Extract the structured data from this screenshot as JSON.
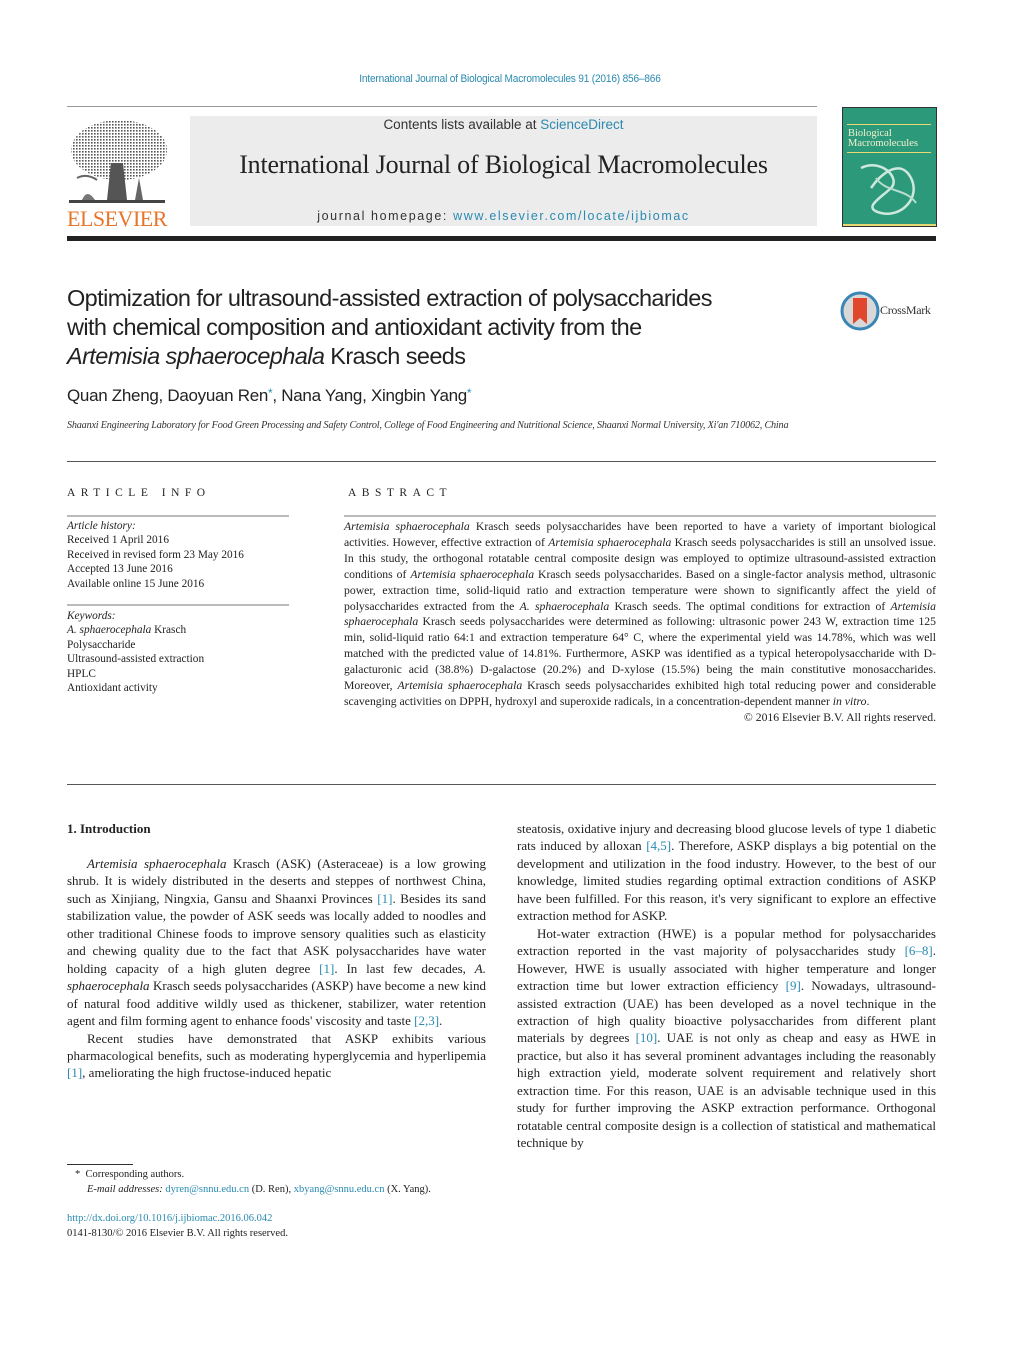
{
  "header": {
    "citation": "International Journal of Biological Macromolecules 91 (2016) 856–866",
    "contents_prefix": "Contents lists available at ",
    "contents_link": "ScienceDirect",
    "journal_name": "International Journal of Biological Macromolecules",
    "homepage_prefix": "journal homepage: ",
    "homepage_link": "www.elsevier.com/locate/ijbiomac",
    "publisher_logo_text": "ELSEVIER",
    "cover_title_line1": "Biological",
    "cover_title_line2": "Macromolecules",
    "crossmark_label": "CrossMark"
  },
  "colors": {
    "link": "#2a8ab0",
    "elsevier_orange": "#e8752a",
    "banner_gray": "#ececec",
    "cover_green": "#2c9a7a"
  },
  "article": {
    "title_line1": "Optimization for ultrasound-assisted extraction of polysaccharides",
    "title_line2": "with chemical composition and antioxidant activity from the",
    "title_line3_italic": "Artemisia sphaerocephala",
    "title_line3_rest": " Krasch seeds",
    "authors": [
      {
        "name": "Quan Zheng",
        "corresponding": false
      },
      {
        "name": "Daoyuan Ren",
        "corresponding": true
      },
      {
        "name": "Nana Yang",
        "corresponding": false
      },
      {
        "name": "Xingbin Yang",
        "corresponding": true
      }
    ],
    "author_sep": ", ",
    "star": "*",
    "affiliation": "Shaanxi Engineering Laboratory for Food Green Processing and Safety Control, College of Food Engineering and Nutritional Science, Shaanxi Normal University, Xi'an 710062, China"
  },
  "article_info": {
    "heading": "ARTICLE INFO",
    "history_label": "Article history:",
    "history": [
      "Received 1 April 2016",
      "Received in revised form 23 May 2016",
      "Accepted 13 June 2016",
      "Available online 15 June 2016"
    ],
    "keywords_label": "Keywords:",
    "keyword1_italic": "A. sphaerocephala",
    "keyword1_rest": " Krasch",
    "keywords": [
      "Polysaccharide",
      "Ultrasound-assisted extraction",
      "HPLC",
      "Antioxidant activity"
    ]
  },
  "abstract": {
    "heading": "ABSTRACT",
    "segments": [
      {
        "t": "Artemisia sphaerocephala",
        "i": true
      },
      {
        "t": " Krasch seeds polysaccharides have been reported to have a variety of important biological activities. However, effective extraction of ",
        "i": false
      },
      {
        "t": "Artemisia sphaerocephala",
        "i": true
      },
      {
        "t": " Krasch seeds polysaccharides is still an unsolved issue. In this study, the orthogonal rotatable central composite design was employed to optimize ultrasound-assisted extraction conditions of ",
        "i": false
      },
      {
        "t": "Artemisia sphaerocephala",
        "i": true
      },
      {
        "t": " Krasch seeds polysaccharides. Based on a single-factor analysis method, ultrasonic power, extraction time, solid-liquid ratio and extraction temperature were shown to significantly affect the yield of polysaccharides extracted from the ",
        "i": false
      },
      {
        "t": "A. sphaerocephala",
        "i": true
      },
      {
        "t": " Krasch seeds. The optimal conditions for extraction of ",
        "i": false
      },
      {
        "t": "Artemisia sphaerocephala",
        "i": true
      },
      {
        "t": " Krasch seeds polysaccharides were determined as following: ultrasonic power 243 W, extraction time 125 min, solid-liquid ratio 64:1 and extraction temperature 64° C, where the experimental yield was 14.78%, which was well matched with the predicted value of 14.81%. Furthermore, ASKP was identified as a typical heteropolysaccharide with D-galacturonic acid (38.8%) D-galactose (20.2%) and D-xylose (15.5%) being the main constitutive monosaccharides. Moreover, ",
        "i": false
      },
      {
        "t": "Artemisia sphaerocephala",
        "i": true
      },
      {
        "t": " Krasch seeds polysaccharides exhibited high total reducing power and considerable scavenging activities on DPPH, hydroxyl and superoxide radicals, in a concentration-dependent manner ",
        "i": false
      },
      {
        "t": "in vitro",
        "i": true
      },
      {
        "t": ".",
        "i": false
      }
    ],
    "copyright": "© 2016 Elsevier B.V. All rights reserved."
  },
  "introduction": {
    "heading": "1.  Introduction",
    "left_paragraphs": [
      [
        {
          "t": "Artemisia sphaerocephala",
          "i": true
        },
        {
          "t": " Krasch (ASK) (Asteraceae) is a low growing shrub. It is widely distributed in the deserts and steppes of northwest China, such as Xinjiang, Ningxia, Gansu and Shaanxi Provinces ",
          "i": false
        },
        {
          "t": "[1]",
          "ref": true
        },
        {
          "t": ". Besides its sand stabilization value, the powder of ASK seeds was locally added to noodles and other traditional Chinese foods to improve sensory qualities such as elasticity and chewing quality due to the fact that ASK polysaccharides have water holding capacity of a high gluten degree ",
          "i": false
        },
        {
          "t": "[1]",
          "ref": true
        },
        {
          "t": ". In last few decades, ",
          "i": false
        },
        {
          "t": "A. sphaerocephala",
          "i": true
        },
        {
          "t": " Krasch seeds polysaccharides (ASKP) have become a new kind of natural food additive wildly used as thickener, stabilizer, water retention agent and film forming agent to enhance foods' viscosity and taste ",
          "i": false
        },
        {
          "t": "[2,3]",
          "ref": true
        },
        {
          "t": ".",
          "i": false
        }
      ],
      [
        {
          "t": "Recent studies have demonstrated that ASKP exhibits various pharmacological benefits, such as moderating hyperglycemia and hyperlipemia ",
          "i": false
        },
        {
          "t": "[1]",
          "ref": true
        },
        {
          "t": ", ameliorating the high fructose-induced hepatic",
          "i": false
        }
      ]
    ],
    "right_paragraphs": [
      [
        {
          "t": "steatosis, oxidative injury and decreasing blood glucose levels of type 1 diabetic rats induced by alloxan ",
          "i": false
        },
        {
          "t": "[4,5]",
          "ref": true
        },
        {
          "t": ". Therefore, ASKP displays a big potential on the development and utilization in the food industry. However, to the best of our knowledge, limited studies regarding optimal extraction conditions of ASKP have been fulfilled. For this reason, it's very significant to explore an effective extraction method for ASKP.",
          "i": false
        }
      ],
      [
        {
          "t": "Hot-water extraction (HWE) is a popular method for polysaccharides extraction reported in the vast majority of polysaccharides study ",
          "i": false
        },
        {
          "t": "[6–8]",
          "ref": true
        },
        {
          "t": ". However, HWE is usually associated with higher temperature and longer extraction time but lower extraction efficiency ",
          "i": false
        },
        {
          "t": "[9]",
          "ref": true
        },
        {
          "t": ". Nowadays, ultrasound-assisted extraction (UAE) has been developed as a novel technique in the extraction of high quality bioactive polysaccharides from different plant materials by degrees ",
          "i": false
        },
        {
          "t": "[10]",
          "ref": true
        },
        {
          "t": ". UAE is not only as cheap and easy as HWE in practice, but also it has several prominent advantages including the reasonably high extraction yield, moderate solvent requirement and relatively short extraction time. For this reason, UAE is an advisable technique used in this study for further improving the ASKP extraction performance. Orthogonal rotatable central composite design is a collection of statistical and mathematical technique by",
          "i": false
        }
      ]
    ]
  },
  "footnotes": {
    "star": "*",
    "corresponding": "Corresponding authors.",
    "email_label": "E-mail addresses:",
    "email1": "dyren@snnu.edu.cn",
    "email1_who": " (D. Ren), ",
    "email2": "xbyang@snnu.edu.cn",
    "email2_who": " (X. Yang).",
    "doi": "http://dx.doi.org/10.1016/j.ijbiomac.2016.06.042",
    "issn": "0141-8130/© 2016 Elsevier B.V. All rights reserved."
  }
}
